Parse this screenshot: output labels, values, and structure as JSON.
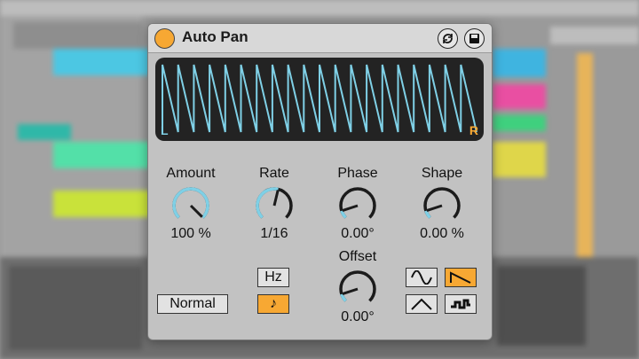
{
  "device": {
    "title": "Auto Pan",
    "power_on": true,
    "accent_color": "#f7a833",
    "wave_color": "#7fd0e6"
  },
  "display": {
    "left_label": "L",
    "right_label": "R",
    "cycles": 20
  },
  "knobs": {
    "amount": {
      "label": "Amount",
      "value": "100 %",
      "level": 1.0
    },
    "rate": {
      "label": "Rate",
      "value": "1/16",
      "level": 0.55
    },
    "phase": {
      "label": "Phase",
      "value": "0.00°",
      "level": 0.1
    },
    "shape": {
      "label": "Shape",
      "value": "0.00 %",
      "level": 0.1
    },
    "offset": {
      "label": "Offset",
      "value": "0.00°",
      "level": 0.1
    }
  },
  "buttons": {
    "mode": "Normal",
    "hz": "Hz",
    "note": "♪"
  },
  "waveform_selector": {
    "selected": "sawtooth-down",
    "options": [
      "sine",
      "sawtooth-down",
      "triangle",
      "random"
    ]
  }
}
